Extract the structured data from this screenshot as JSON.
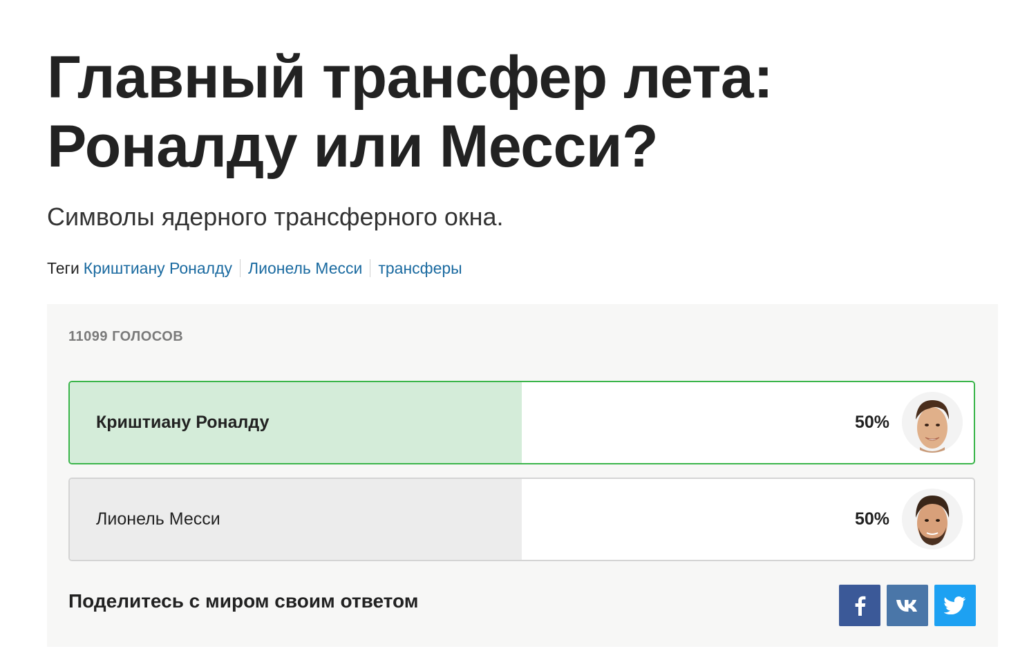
{
  "article": {
    "headline_line1": "Главный трансфер лета:",
    "headline_line2": "Роналду или Месси?",
    "subtitle": "Символы ядерного трансферного окна.",
    "tags_label": "Теги",
    "tags": [
      "Криштиану Роналду",
      "Лионель Месси",
      "трансферы"
    ]
  },
  "poll": {
    "votes_label": "11099 ГОЛОСОВ",
    "options": [
      {
        "label": "Криштиану Роналду",
        "percent_text": "50%",
        "share": 0.5,
        "selected": true,
        "avatar_icon": "ronaldo-portrait-icon"
      },
      {
        "label": "Лионель Месси",
        "percent_text": "50%",
        "share": 0.5,
        "selected": false,
        "avatar_icon": "messi-portrait-icon"
      }
    ],
    "share_text": "Поделитесь с миром своим ответом",
    "share_buttons": [
      {
        "name": "facebook",
        "icon": "facebook-icon",
        "color": "#3b5998"
      },
      {
        "name": "vk",
        "icon": "vk-icon",
        "color": "#4a76a8"
      },
      {
        "name": "twitter",
        "icon": "twitter-icon",
        "color": "#1da1f2"
      }
    ]
  },
  "colors": {
    "heading": "#222222",
    "tag_link": "#1a6aa0",
    "selected_border": "#3ab54a",
    "selected_fill": "#d4ecd9",
    "other_fill": "#ececec",
    "poll_background": "#f7f7f6"
  }
}
